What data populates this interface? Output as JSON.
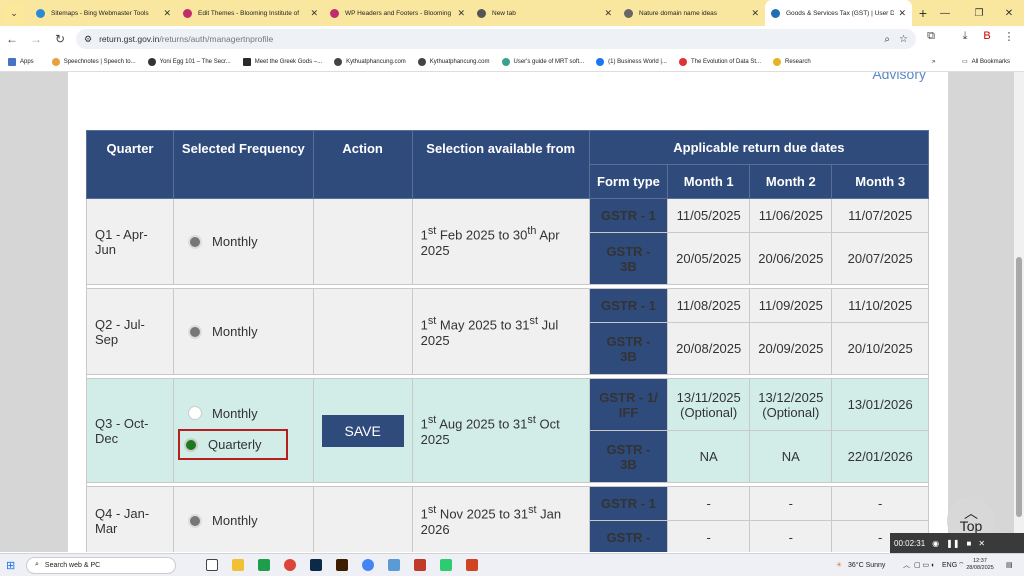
{
  "browser": {
    "tabs": [
      {
        "label": "Sitemaps - Bing Webmaster Tools",
        "icon": "bing-favicon",
        "active": false
      },
      {
        "label": "Edit Themes - Blooming Institute of",
        "icon": "wordpress-favicon",
        "active": false
      },
      {
        "label": "WP Headers and Footers - Blooming",
        "icon": "wordpress-favicon",
        "active": false
      },
      {
        "label": "New tab",
        "icon": "chrome-favicon",
        "active": false
      },
      {
        "label": "Nature domain name ideas",
        "icon": "globe-favicon",
        "active": false
      },
      {
        "label": "Goods & Services Tax (GST) | User D",
        "icon": "gst-favicon",
        "active": true
      }
    ],
    "url_host": "return.gst.gov.in",
    "url_path": "/returns/auth/managertnprofile",
    "bookmarks": [
      {
        "label": "Apps"
      },
      {
        "label": "Speechnotes | Speech to..."
      },
      {
        "label": "Yoni Egg 101 – The Secr..."
      },
      {
        "label": "Meet the Greek Gods –..."
      },
      {
        "label": "Kythuatphancung.com"
      },
      {
        "label": "Kythuatphancung.com"
      },
      {
        "label": "User's guide of MRT soft..."
      },
      {
        "label": "(1) Business World |..."
      },
      {
        "label": "The Evolution of Data St..."
      },
      {
        "label": "Research"
      }
    ],
    "all_bookmarks": "All Bookmarks"
  },
  "page": {
    "advisory": "Advisory",
    "headers": {
      "quarter": "Quarter",
      "selected_frequency": "Selected Frequency",
      "action": "Action",
      "selection_available": "Selection available from",
      "applicable": "Applicable return due dates",
      "form_type": "Form type",
      "month1": "Month 1",
      "month2": "Month 2",
      "month3": "Month 3"
    },
    "rows": [
      {
        "quarter": "Q1 - Apr-Jun",
        "frequency": "Monthly",
        "avail_a": "1",
        "sup_a": "st",
        "avail_b": " Feb 2025 to 30",
        "sup_b": "th",
        "avail_c": " Apr 2025",
        "forms": [
          {
            "type": "GSTR - 1",
            "m1": "11/05/2025",
            "m2": "11/06/2025",
            "m3": "11/07/2025"
          },
          {
            "type": "GSTR - 3B",
            "m1": "20/05/2025",
            "m2": "20/06/2025",
            "m3": "20/07/2025"
          }
        ]
      },
      {
        "quarter": "Q2 - Jul-Sep",
        "frequency": "Monthly",
        "avail_a": "1",
        "sup_a": "st",
        "avail_b": " May 2025 to 31",
        "sup_b": "st",
        "avail_c": " Jul 2025",
        "forms": [
          {
            "type": "GSTR - 1",
            "m1": "11/08/2025",
            "m2": "11/09/2025",
            "m3": "11/10/2025"
          },
          {
            "type": "GSTR - 3B",
            "m1": "20/08/2025",
            "m2": "20/09/2025",
            "m3": "20/10/2025"
          }
        ]
      },
      {
        "quarter": "Q3 - Oct-Dec",
        "option_monthly": "Monthly",
        "option_quarterly": "Quarterly",
        "save": "SAVE",
        "avail_a": "1",
        "sup_a": "st",
        "avail_b": " Aug 2025 to 31",
        "sup_b": "st",
        "avail_c": " Oct 2025",
        "forms": [
          {
            "type": "GSTR - 1/ IFF",
            "m1": "13/11/2025 (Optional)",
            "m2": "13/12/2025 (Optional)",
            "m3": "13/01/2026"
          },
          {
            "type": "GSTR - 3B",
            "m1": "NA",
            "m2": "NA",
            "m3": "22/01/2026"
          }
        ]
      },
      {
        "quarter": "Q4 - Jan-Mar",
        "frequency": "Monthly",
        "avail_a": "1",
        "sup_a": "st",
        "avail_b": " Nov 2025 to 31",
        "sup_b": "st",
        "avail_c": " Jan 2026",
        "forms": [
          {
            "type": "GSTR - 1",
            "m1": "-",
            "m2": "-",
            "m3": "-"
          },
          {
            "type": "GSTR -",
            "m1": "-",
            "m2": "-",
            "m3": "-"
          }
        ]
      }
    ],
    "top_label": "Top"
  },
  "recorder": {
    "time": "00:02:31"
  },
  "taskbar": {
    "search": "Search web & PC",
    "weather": "36°C  Sunny",
    "lang": "ENG",
    "time": "12:37",
    "date": "28/08/2025"
  },
  "colors": {
    "header_blue": "#2f4b7c",
    "highlight_row": "#d2ede7",
    "highlight_text": "#3f9b45",
    "tab_strip": "#f9e79f"
  }
}
